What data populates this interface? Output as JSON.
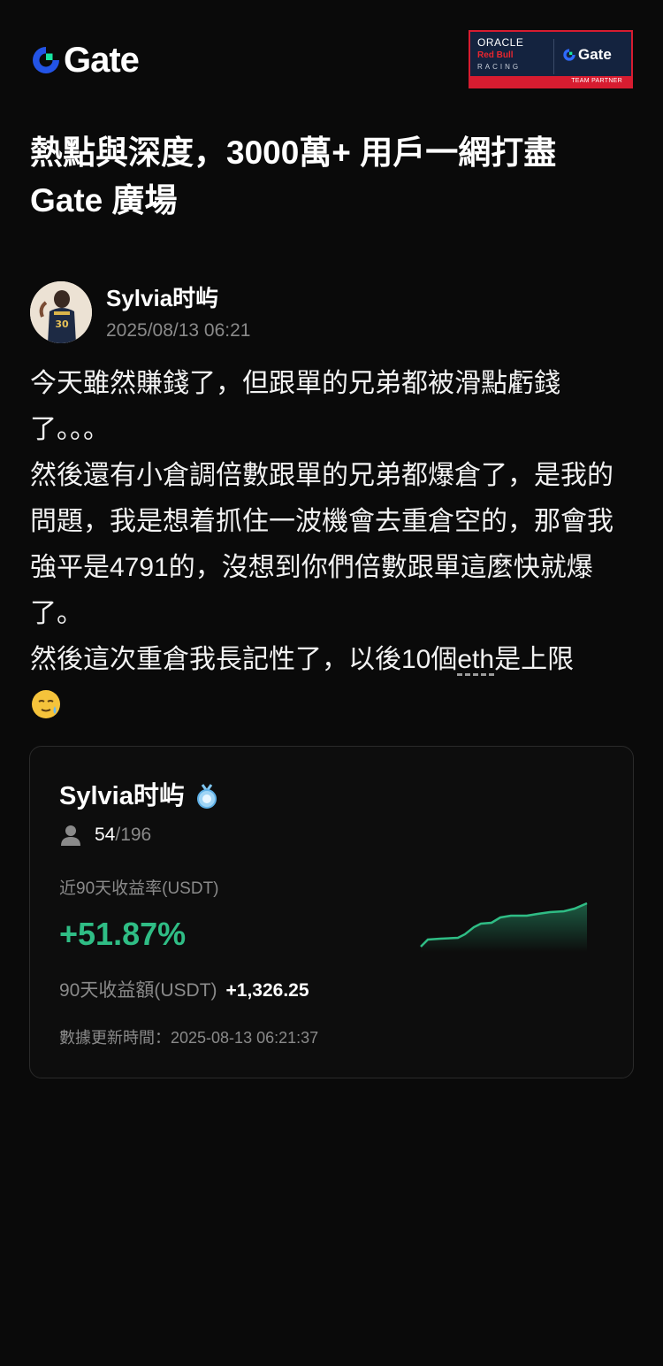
{
  "header": {
    "logo_text": "Gate",
    "banner": {
      "oracle": "ORACLE",
      "redbull": "Red Bull",
      "racing": "RACING",
      "gate": "Gate",
      "team_partner": "TEAM PARTNER"
    }
  },
  "headline": "熱點與深度，3000萬+ 用戶一網打盡 Gate 廣場",
  "post": {
    "author_name": "Sylvia时屿",
    "timestamp": "2025/08/13 06:21",
    "paragraphs": [
      "今天雖然賺錢了，但跟單的兄弟都被滑點虧錢了。。。",
      "然後還有小倉調倍數跟單的兄弟都爆倉了，是我的問題，我是想着抓住一波機會去重倉空的，那會我強平是4791的，沒想到你們倍數跟單這麼快就爆了。"
    ],
    "last_line_before": "然後這次重倉我長記性了，以後10個",
    "last_line_link": "eth",
    "last_line_after": "是上限"
  },
  "card": {
    "name": "Sylvia时屿",
    "followers_current": "54",
    "followers_separator": "/",
    "followers_total": "196",
    "roi_label": "近90天收益率(USDT)",
    "roi_value": "+51.87%",
    "pnl_label": "90天收益額(USDT)",
    "pnl_value": "+1,326.25",
    "updated": "數據更新時間：2025-08-13 06:21:37",
    "accent_color": "#2fbd85"
  },
  "icons": {
    "logo": "gate-logo-icon",
    "avatar": "avatar-image",
    "emoji": "sweat-smile-emoji",
    "medal": "medal-icon",
    "person": "person-icon"
  }
}
